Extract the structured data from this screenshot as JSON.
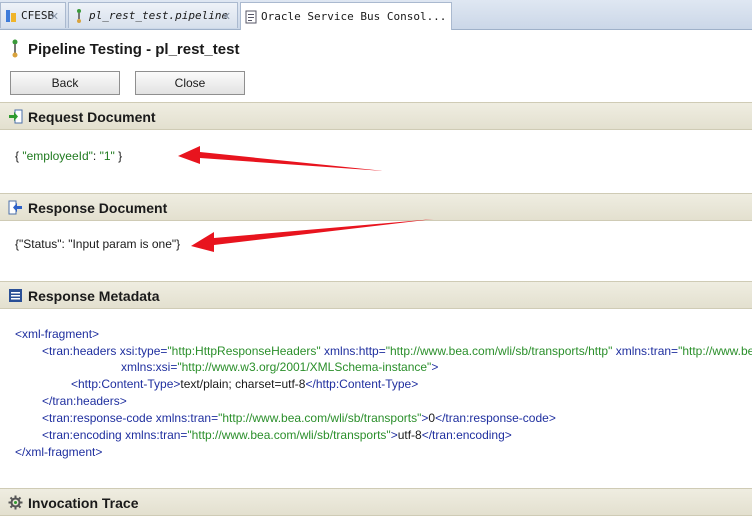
{
  "tabs": [
    {
      "label": "CFESB",
      "italic": false,
      "active": false,
      "close": "✕"
    },
    {
      "label": "pl_rest_test.pipeline",
      "italic": true,
      "active": false,
      "close": "✕"
    },
    {
      "label": "Oracle Service Bus Consol...",
      "italic": false,
      "active": true,
      "close": ""
    }
  ],
  "page": {
    "title": "Pipeline Testing - pl_rest_test"
  },
  "toolbar": {
    "back_label": "Back",
    "close_label": "Close"
  },
  "request": {
    "title": "Request Document",
    "body": {
      "open": "{ ",
      "key": "\"employeeId\"",
      "colon": ":  ",
      "value": "\"1\"",
      "close": " }"
    }
  },
  "response": {
    "title": "Response Document",
    "body": "{\"Status\": \"Input param is one\"}"
  },
  "metadata": {
    "title": "Response Metadata",
    "xml": {
      "l1": "<xml-fragment>",
      "l2_tag": "<tran:headers ",
      "l2_a1": "xsi:type=",
      "l2_v1": "\"http:HttpResponseHeaders\"",
      "l2_a2": " xmlns:http=",
      "l2_v2": "\"http://www.bea.com/wli/sb/transports/http\"",
      "l2_a3": " xmlns:tran=",
      "l2_v3": "\"http://www.bea.com/wli/sb/transports\"",
      "l3_a": "xmlns:xsi=",
      "l3_v": "\"http://www.w3.org/2001/XMLSchema-instance\"",
      "l3_end": ">",
      "l4_open": "<http:Content-Type>",
      "l4_text": "text/plain; charset=utf-8",
      "l4_close": "</http:Content-Type>",
      "l5": "</tran:headers>",
      "l6_tag": "<tran:response-code ",
      "l6_a": "xmlns:tran=",
      "l6_v": "\"http://www.bea.com/wli/sb/transports\"",
      "l6_gt": ">",
      "l6_text": "0",
      "l6_close": "</tran:response-code>",
      "l7_tag": "<tran:encoding ",
      "l7_a": "xmlns:tran=",
      "l7_v": "\"http://www.bea.com/wli/sb/transports\"",
      "l7_gt": ">",
      "l7_text": "utf-8",
      "l7_close": "</tran:encoding>",
      "l8": "</xml-fragment>"
    }
  },
  "trace": {
    "title": "Invocation Trace"
  },
  "colors": {
    "section_header": "#e3e0cf",
    "xml_tag": "#1f2f9f",
    "xml_value": "#2b8f2b",
    "annotation_arrow": "#e8141e"
  },
  "icons": {
    "tab1": "project-icon",
    "tab2": "pipeline-icon",
    "tab3": "console-page-icon",
    "title": "pipeline-icon",
    "request": "import-arrow-icon",
    "response": "export-arrow-icon",
    "metadata": "document-list-icon",
    "trace": "gear-trace-icon"
  }
}
